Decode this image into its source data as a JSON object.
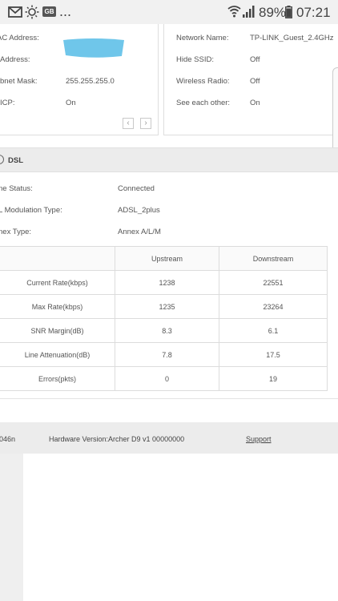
{
  "status_bar": {
    "icons": [
      "mail-icon",
      "brightness-icon",
      "gallery-badge-icon",
      "more-icon",
      "wifi-icon",
      "signal-icon"
    ],
    "badge_text": "GB",
    "more_text": "...",
    "battery": "89%",
    "time": "07:21"
  },
  "network_panel": {
    "rows": [
      {
        "label": "AC Address:",
        "value": ""
      },
      {
        "label": "Address:",
        "value": ""
      },
      {
        "label": "bnet Mask:",
        "value": "255.255.255.0"
      },
      {
        "label": "ICP:",
        "value": "On"
      }
    ]
  },
  "wireless_panel": {
    "rows": [
      {
        "label": "Network Name:",
        "value": "TP-LINK_Guest_2.4GHz"
      },
      {
        "label": "Hide SSID:",
        "value": "Off"
      },
      {
        "label": "Wireless Radio:",
        "value": "Off"
      },
      {
        "label": "See each other:",
        "value": "On"
      }
    ]
  },
  "pager": {
    "prev": "‹",
    "next": "›"
  },
  "dsl": {
    "title": "DSL",
    "rows": [
      {
        "label": "ne Status:",
        "value": "Connected"
      },
      {
        "label": "L Modulation Type:",
        "value": "ADSL_2plus"
      },
      {
        "label": "nex Type:",
        "value": "Annex A/L/M"
      }
    ],
    "table": {
      "headers": [
        "",
        "Upstream",
        "Downstream"
      ],
      "rows": [
        [
          "Current Rate(kbps)",
          "1238",
          "22551"
        ],
        [
          "Max Rate(kbps)",
          "1235",
          "23264"
        ],
        [
          "SNR Margin(dB)",
          "8.3",
          "6.1"
        ],
        [
          "Line Attenuation(dB)",
          "7.8",
          "17.5"
        ],
        [
          "Errors(pkts)",
          "0",
          "19"
        ]
      ]
    }
  },
  "footer": {
    "firmware_fragment": "046n",
    "hardware": "Hardware Version:Archer D9 v1 00000000",
    "support": "Support"
  },
  "colors": {
    "redaction": "#6fc6ea",
    "section_bg": "#ececec",
    "border": "#dcdcdc"
  }
}
